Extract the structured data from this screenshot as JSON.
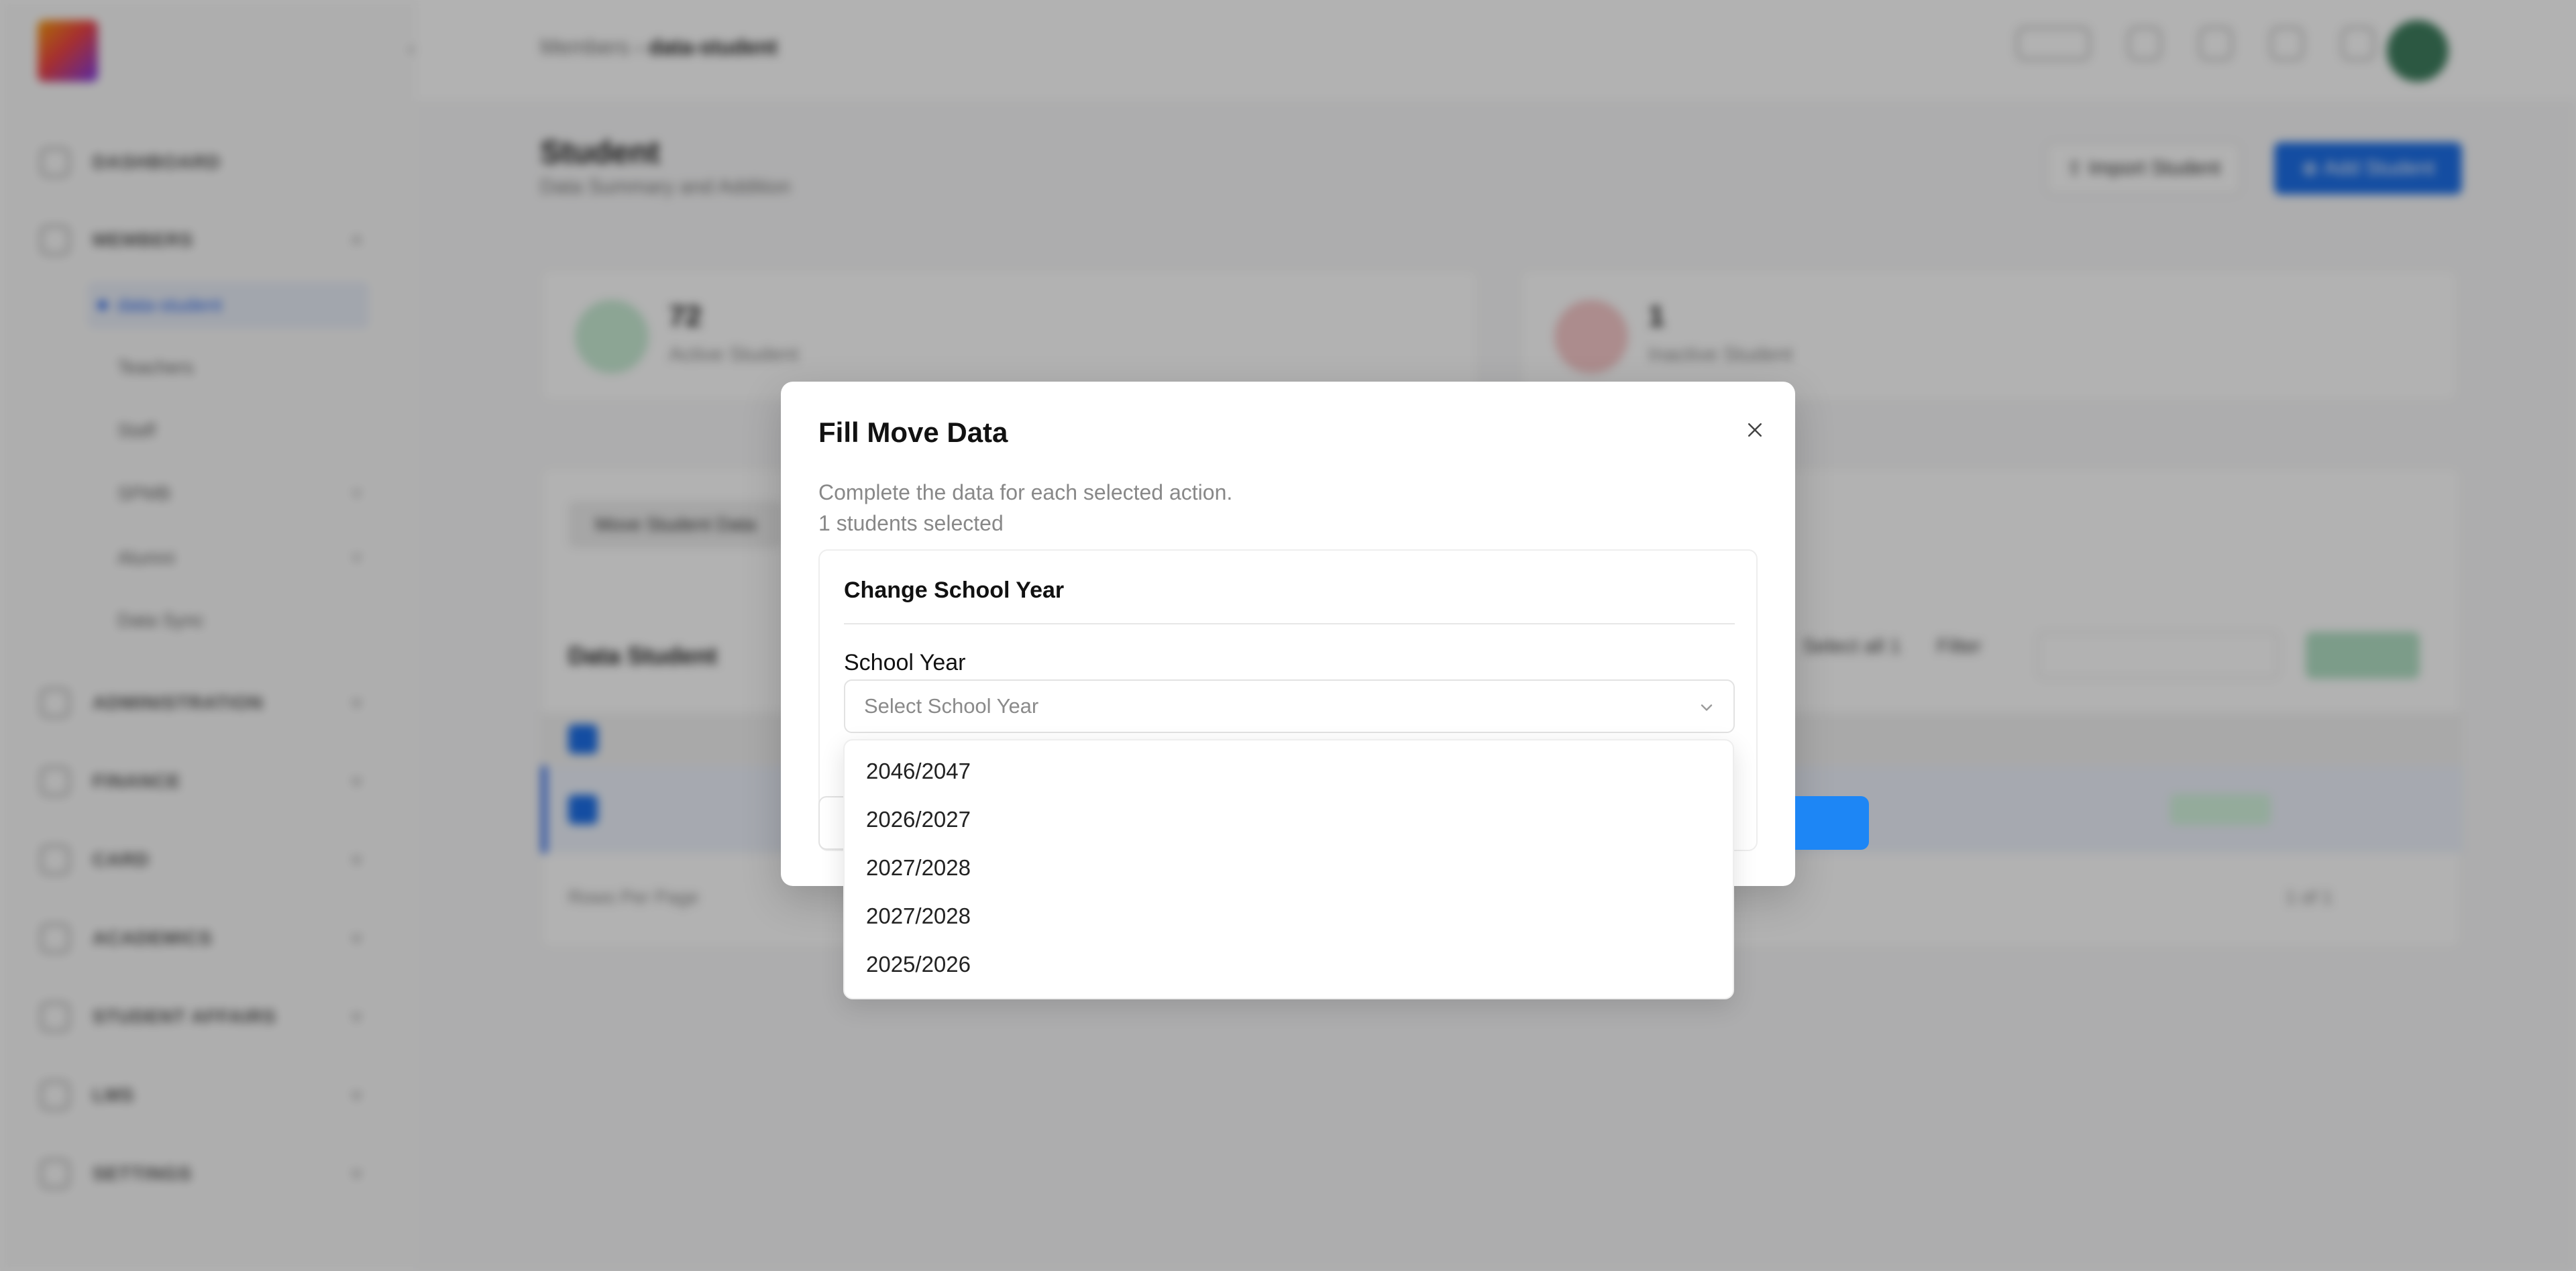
{
  "background": {
    "breadcrumb": {
      "parent": "Members",
      "current": "data-student"
    },
    "sidebar": {
      "items": [
        {
          "label": "DASHBOARD"
        },
        {
          "label": "MEMBERS"
        },
        {
          "label": "ADMINISTRATION"
        },
        {
          "label": "FINANCE"
        },
        {
          "label": "CARD"
        },
        {
          "label": "ACADEMICS"
        },
        {
          "label": "STUDENT AFFAIRS"
        },
        {
          "label": "LMS"
        },
        {
          "label": "SETTINGS"
        }
      ],
      "sub_items": [
        {
          "label": "data-student"
        },
        {
          "label": "Teachers"
        },
        {
          "label": "Staff"
        },
        {
          "label": "SPMB"
        },
        {
          "label": "Alumni"
        },
        {
          "label": "Data Sync"
        }
      ]
    },
    "page": {
      "title": "Student",
      "subtitle": "Data Summary and Addition",
      "import_label": "Import Student",
      "add_label": "Add Student"
    },
    "stats": [
      {
        "value": "72",
        "label": "Active Student",
        "color": "#22a559"
      },
      {
        "value": "1",
        "label": "Inactive Student",
        "color": "#e0464a"
      }
    ],
    "panel": {
      "chip_label": "Move Student Data",
      "data_title": "Data Student",
      "select_all": "Select all 1",
      "filter_label": "Filter",
      "excel_label": "Excel",
      "rows_per_page": "Rows Per Page",
      "pagination": "1 of 1"
    }
  },
  "modal": {
    "title": "Fill Move Data",
    "description": "Complete the data for each selected action.",
    "selected_count": "1 students selected",
    "section_title": "Change School Year",
    "field_label": "School Year",
    "select_placeholder": "Select School Year",
    "options": [
      {
        "label": "2046/2047"
      },
      {
        "label": "2026/2027"
      },
      {
        "label": "2027/2028"
      },
      {
        "label": "2027/2028"
      },
      {
        "label": "2025/2026"
      }
    ]
  },
  "colors": {
    "accent": "#1d6fe8",
    "overlay": "rgba(0,0,0,0.30)"
  }
}
